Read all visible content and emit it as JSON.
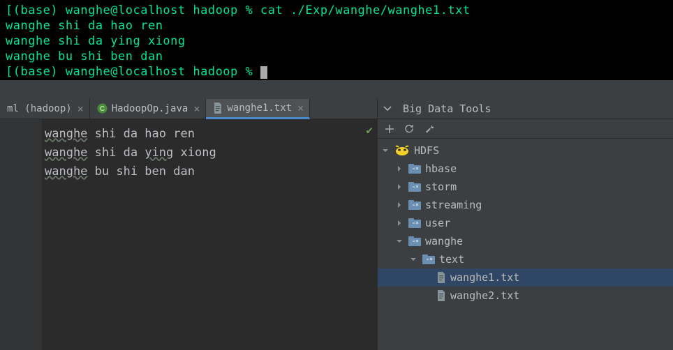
{
  "terminal": {
    "prompt1_left": "[(base) wanghe@localhost hadoop % ",
    "cmd1": "cat ./Exp/wanghe/wanghe1.txt",
    "lines": [
      "wanghe shi da hao ren",
      "wanghe shi da ying xiong",
      "wanghe bu shi ben dan"
    ],
    "prompt2": "[(base) wanghe@localhost hadoop % "
  },
  "tabs": [
    {
      "label": "ml (hadoop)",
      "closeable": true,
      "icon": null,
      "active": false
    },
    {
      "label": "HadoopOp.java",
      "closeable": true,
      "icon": "java",
      "active": false
    },
    {
      "label": "wanghe1.txt",
      "closeable": true,
      "icon": "file",
      "active": true
    }
  ],
  "editor": {
    "lines": [
      {
        "w1": "wanghe",
        "rest": " shi da hao ren"
      },
      {
        "w1": "wanghe",
        "rest": " shi da ",
        "w2": "ying",
        "rest2": " xiong"
      },
      {
        "w1": "wanghe",
        "rest": " bu shi ben dan"
      }
    ]
  },
  "tools": {
    "title": "Big Data Tools",
    "tree": [
      {
        "depth": 0,
        "arrow": "down",
        "icon": "hadoop",
        "label": "HDFS",
        "sel": false
      },
      {
        "depth": 1,
        "arrow": "right",
        "icon": "folder",
        "label": "hbase",
        "sel": false
      },
      {
        "depth": 1,
        "arrow": "right",
        "icon": "folder",
        "label": "storm",
        "sel": false
      },
      {
        "depth": 1,
        "arrow": "right",
        "icon": "folder",
        "label": "streaming",
        "sel": false
      },
      {
        "depth": 1,
        "arrow": "right",
        "icon": "folder",
        "label": "user",
        "sel": false
      },
      {
        "depth": 1,
        "arrow": "down",
        "icon": "folder",
        "label": "wanghe",
        "sel": false
      },
      {
        "depth": 2,
        "arrow": "down",
        "icon": "folder",
        "label": "text",
        "sel": false
      },
      {
        "depth": 3,
        "arrow": "",
        "icon": "file",
        "label": "wanghe1.txt",
        "sel": true
      },
      {
        "depth": 3,
        "arrow": "",
        "icon": "file",
        "label": "wanghe2.txt",
        "sel": false
      }
    ]
  }
}
